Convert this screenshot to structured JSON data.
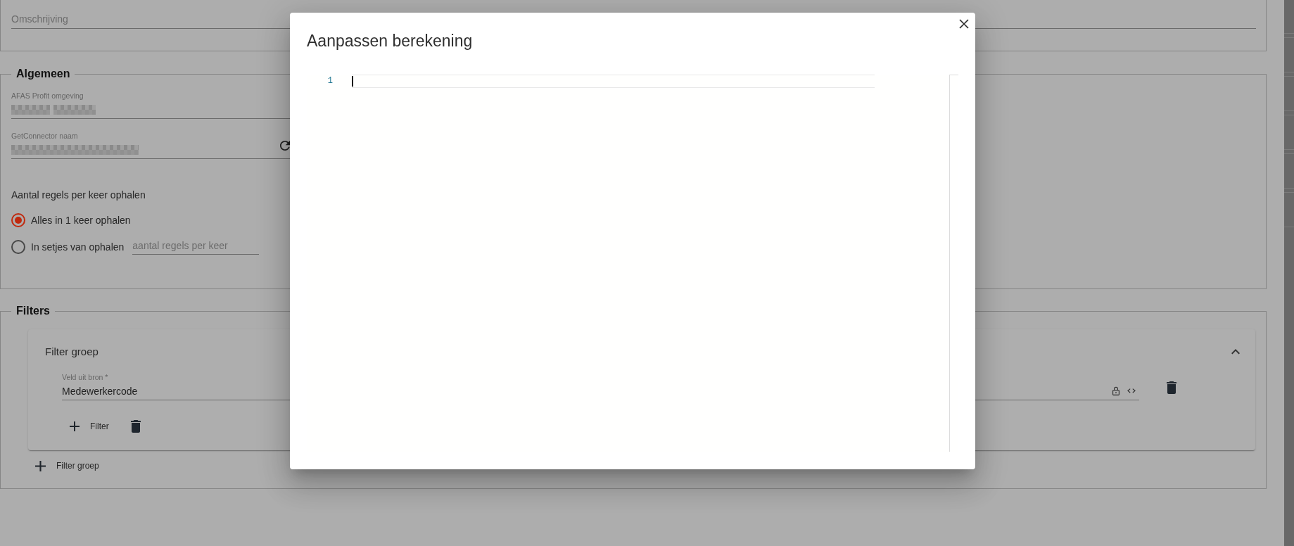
{
  "description_field": {
    "placeholder": "Omschrijving"
  },
  "general": {
    "legend": "Algemeen",
    "fields": [
      {
        "label": "AFAS Profit omgeving",
        "value_blurred": true,
        "refresh_button": false
      },
      {
        "label": "GetConnector naam",
        "value_blurred": true,
        "refresh_button": true
      }
    ],
    "fetch_mode": {
      "label": "Aantal regels per keer ophalen",
      "options": [
        {
          "label": "Alles in 1 keer ophalen",
          "selected": true
        },
        {
          "label": "In setjes van ophalen",
          "selected": false,
          "input": {
            "placeholder": "aantal regels per keer"
          }
        }
      ]
    }
  },
  "filters": {
    "legend": "Filters",
    "groups": [
      {
        "title": "Filter groep",
        "expanded": true,
        "field": {
          "label": "Veld uit bron *",
          "value": "Medewerkercode"
        },
        "add_filter_button": "Filter"
      }
    ],
    "add_group_button": "Filter groep"
  },
  "dialog": {
    "title": "Aanpassen berekening",
    "editor": {
      "lines": [
        {
          "number": "1",
          "active": true
        }
      ]
    }
  }
}
